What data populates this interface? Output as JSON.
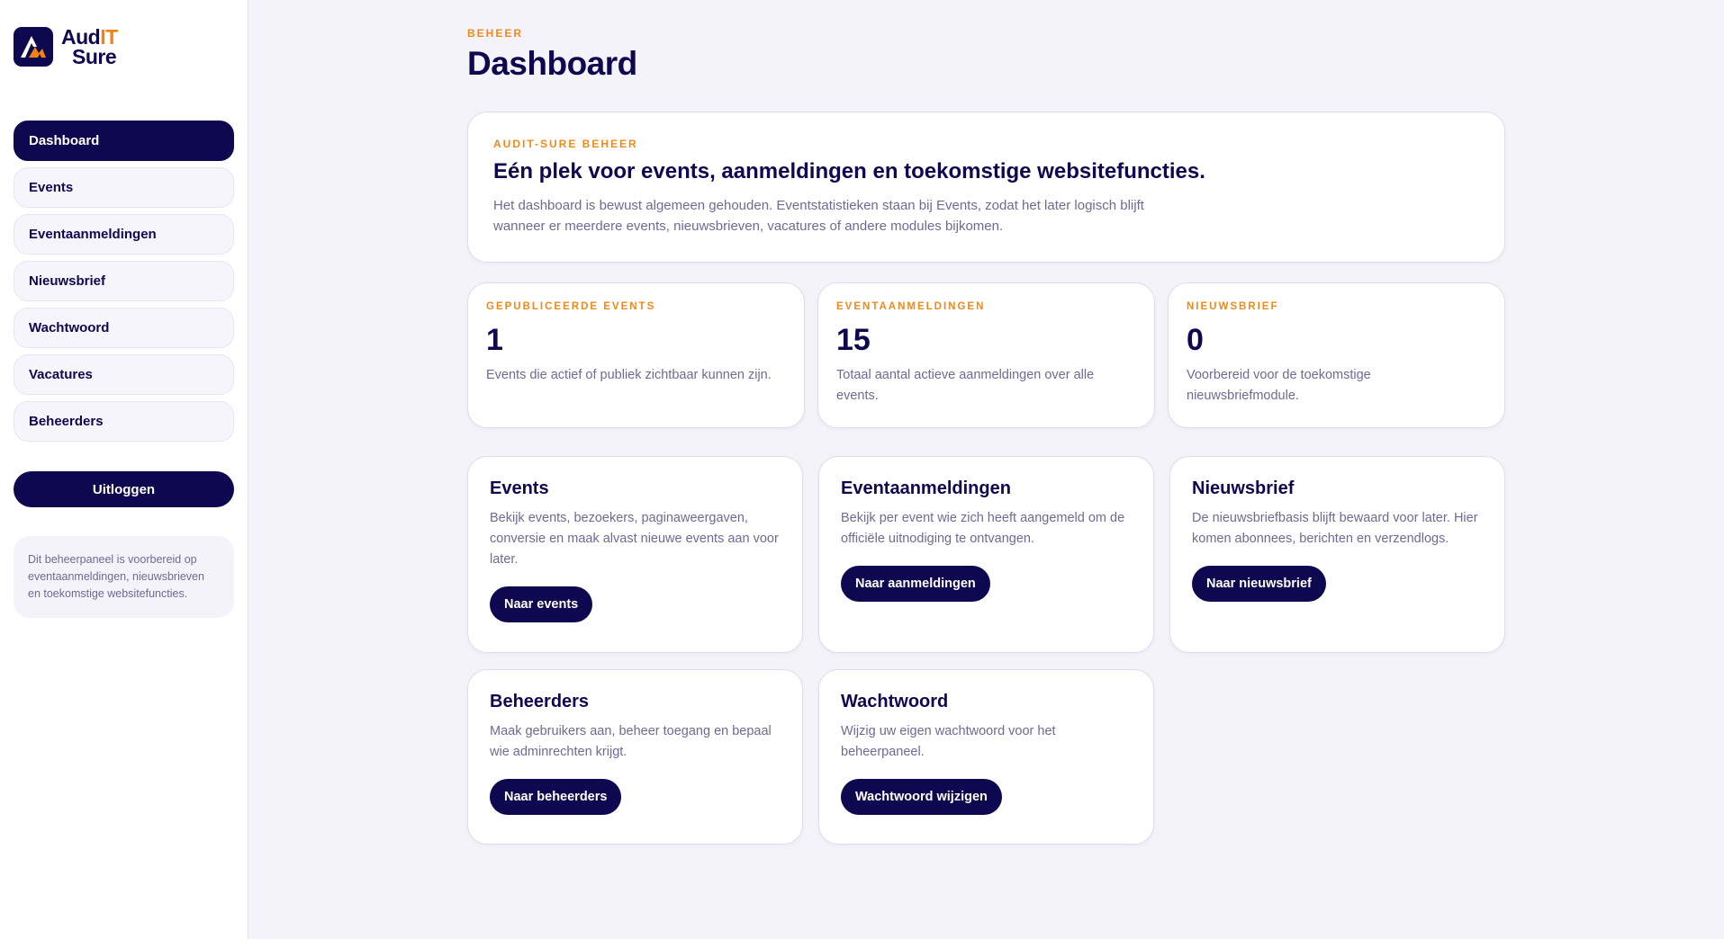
{
  "brand": {
    "name_part1": "Aud",
    "name_accent": "IT",
    "name_part2": "Sure",
    "primary_color": "#0d0850",
    "accent_color": "#f08312"
  },
  "sidebar": {
    "items": [
      {
        "label": "Dashboard",
        "active": true
      },
      {
        "label": "Events",
        "active": false
      },
      {
        "label": "Eventaanmeldingen",
        "active": false
      },
      {
        "label": "Nieuwsbrief",
        "active": false
      },
      {
        "label": "Wachtwoord",
        "active": false
      },
      {
        "label": "Vacatures",
        "active": false
      },
      {
        "label": "Beheerders",
        "active": false
      }
    ],
    "logout_label": "Uitloggen",
    "note": "Dit beheerpaneel is voorbereid op eventaanmeldingen, nieuwsbrieven en toekomstige websitefuncties."
  },
  "header": {
    "eyebrow": "BEHEER",
    "title": "Dashboard"
  },
  "hero": {
    "eyebrow": "AUDIT-SURE BEHEER",
    "heading": "Eén plek voor events, aanmeldingen en toekomstige websitefuncties.",
    "text": "Het dashboard is bewust algemeen gehouden. Eventstatistieken staan bij Events, zodat het later logisch blijft wanneer er meerdere events, nieuwsbrieven, vacatures of andere modules bijkomen."
  },
  "stats": [
    {
      "label": "GEPUBLICEERDE EVENTS",
      "value": "1",
      "desc": "Events die actief of publiek zichtbaar kunnen zijn."
    },
    {
      "label": "EVENTAANMELDINGEN",
      "value": "15",
      "desc": "Totaal aantal actieve aanmeldingen over alle events."
    },
    {
      "label": "NIEUWSBRIEF",
      "value": "0",
      "desc": "Voorbereid voor de toekomstige nieuwsbriefmodule."
    }
  ],
  "modules": [
    {
      "title": "Events",
      "desc": "Bekijk events, bezoekers, paginaweergaven, conversie en maak alvast nieuwe events aan voor later.",
      "button": "Naar events"
    },
    {
      "title": "Eventaanmeldingen",
      "desc": "Bekijk per event wie zich heeft aangemeld om de officiële uitnodiging te ontvangen.",
      "button": "Naar aanmeldingen"
    },
    {
      "title": "Nieuwsbrief",
      "desc": "De nieuwsbriefbasis blijft bewaard voor later. Hier komen abonnees, berichten en verzendlogs.",
      "button": "Naar nieuwsbrief"
    },
    {
      "title": "Beheerders",
      "desc": "Maak gebruikers aan, beheer toegang en bepaal wie adminrechten krijgt.",
      "button": "Naar beheerders"
    },
    {
      "title": "Wachtwoord",
      "desc": "Wijzig uw eigen wachtwoord voor het beheerpaneel.",
      "button": "Wachtwoord wijzigen"
    }
  ]
}
